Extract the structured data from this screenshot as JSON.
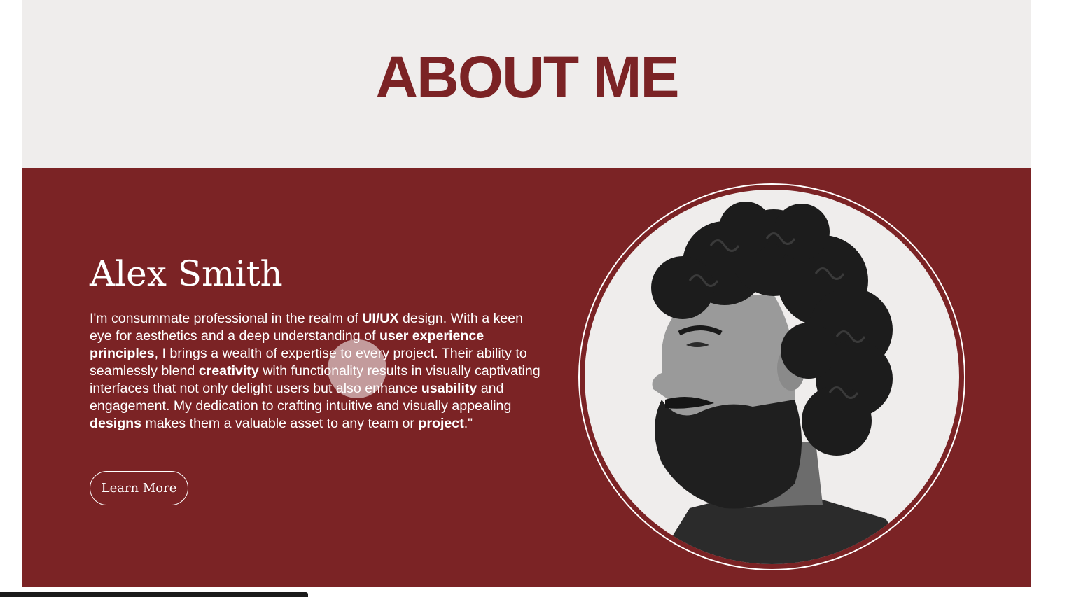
{
  "header": {
    "title": "ABOUT ME"
  },
  "about": {
    "name": "Alex Smith",
    "bio_segments": [
      {
        "text": "I'm consummate professional in the realm of ",
        "bold": false
      },
      {
        "text": "UI/UX",
        "bold": true
      },
      {
        "text": " design. With a keen eye for aesthetics and a deep understanding of ",
        "bold": false
      },
      {
        "text": "user experience principles",
        "bold": true
      },
      {
        "text": ", I brings a wealth of expertise to every project. Their ability to seamlessly blend ",
        "bold": false
      },
      {
        "text": "creativity",
        "bold": true
      },
      {
        "text": " with functionality results in visually captivating interfaces that not only delight users but also enhance ",
        "bold": false
      },
      {
        "text": "usability",
        "bold": true
      },
      {
        "text": " and engagement. My dedication to crafting intuitive and visually appealing ",
        "bold": false
      },
      {
        "text": "designs",
        "bold": true
      },
      {
        "text": " makes them a valuable asset to any team or ",
        "bold": false
      },
      {
        "text": "project",
        "bold": true
      },
      {
        "text": ".\"",
        "bold": false
      }
    ],
    "button_label": "Learn More",
    "photo_icon": "portrait-photo"
  },
  "colors": {
    "brand": "#7b2325",
    "background_light": "#efedec",
    "text_on_brand": "#ffffff"
  }
}
